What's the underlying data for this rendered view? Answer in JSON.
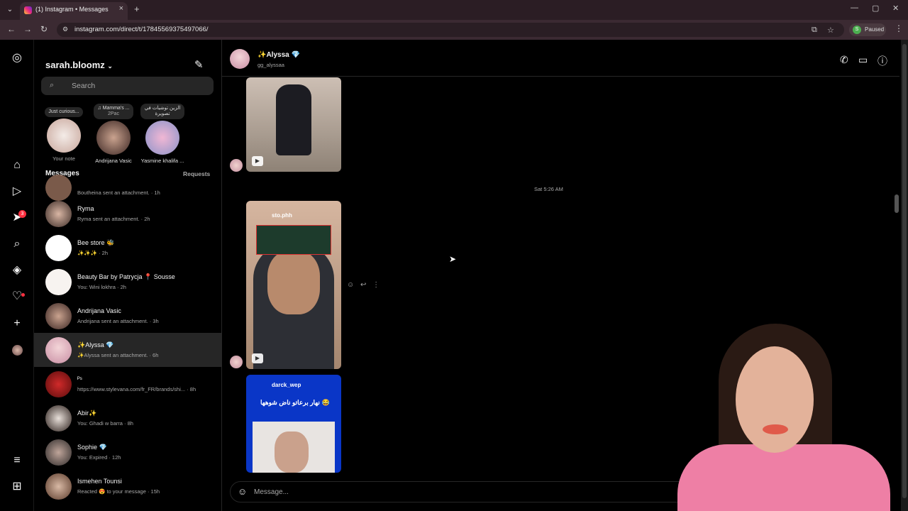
{
  "browser": {
    "tab_title": "(1) Instagram • Messages",
    "url": "instagram.com/direct/t/17845569375497066/",
    "profile_initial": "S",
    "profile_status": "Paused"
  },
  "inbox": {
    "username": "sarah.bloomz",
    "search_placeholder": "Search",
    "notes": [
      {
        "bubble": "Just curious...",
        "label": "Your note"
      },
      {
        "bubble": "Mamma's ...",
        "bubble2": "2Pac",
        "label": "Andrijana Vasic"
      },
      {
        "bubble": "الزين توشيات في تصويرة",
        "label": "Yasmine khalifa ..."
      }
    ],
    "messages_header": "Messages",
    "requests_label": "Requests",
    "conversations": [
      {
        "name": "",
        "sub": "Boutheina sent an attachment. · 1h"
      },
      {
        "name": "Ryma",
        "sub": "Ryma sent an attachment. · 2h"
      },
      {
        "name": "Bee store 🐝",
        "sub": "✨✨✨ · 2h"
      },
      {
        "name": "Beauty Bar by Patrycja 📍 Sousse",
        "sub": "You: Wini lokhra · 2h"
      },
      {
        "name": "Andrijana Vasic",
        "sub": "Andrijana sent an attachment. · 3h"
      },
      {
        "name": "✨Alyssa 💎",
        "sub": "✨Alyssa sent an attachment. · 6h"
      },
      {
        "name": "ᴾˢ",
        "sub": "https://www.stylevana.com/fr_FR/brands/shi... · 8h"
      },
      {
        "name": "Abir✨",
        "sub": "You: Ghadi w barra · 8h"
      },
      {
        "name": "Sophie 💎",
        "sub": "You: Expired · 12h"
      },
      {
        "name": "Ismehen Tounsi",
        "sub": "Reacted 😍 to your message · 15h"
      }
    ]
  },
  "chat": {
    "contact_name": "✨Alyssa 💎",
    "contact_handle": "gg_alyssaa",
    "timestamp": "Sat 5:26 AM",
    "media2_user": "sto.phh",
    "media3_title": "darck_wep",
    "media3_caption": "نهار برعاتو ناض شوهها 😂",
    "composer_placeholder": "Message..."
  },
  "colors": {
    "background": "#000000",
    "surface": "#262626",
    "muted_text": "#a8a8a8",
    "notification_red": "#ff3040"
  }
}
